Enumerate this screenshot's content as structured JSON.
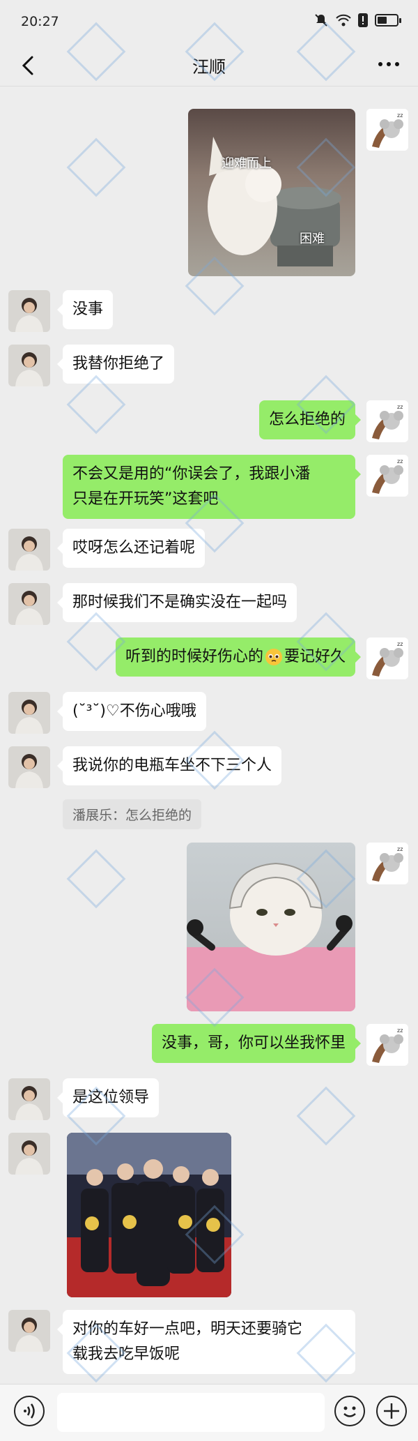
{
  "status": {
    "time": "20:27",
    "battery_level": 0.5
  },
  "header": {
    "title": "汪顺"
  },
  "messages": [
    {
      "text": "没事"
    },
    {
      "text": "我替你拒绝了"
    },
    {
      "text": "怎么拒绝的"
    },
    {
      "line1": "不会又是用的“你误会了，我跟小潘",
      "line2": "只是在开玩笑”这套吧"
    },
    {
      "text": "哎呀怎么还记着呢"
    },
    {
      "text": "那时候我们不是确实没在一起吗"
    },
    {
      "pre": "听到的时候好伤心的",
      "post": "要记好久"
    },
    {
      "text": "(˘³˘)♡不伤心哦哦"
    },
    {
      "text": "我说你的电瓶车坐不下三个人"
    },
    {
      "text": "没事，哥，你可以坐我怀里"
    },
    {
      "text": "是这位领导"
    },
    {
      "line1": "对你的车好一点吧，明天还要骑它",
      "line2": "载我去吃早饭呢"
    }
  ],
  "quote": {
    "text": "潘展乐：怎么拒绝的"
  },
  "sticker1": {
    "top_text": "迎难而上",
    "bottom_text": "困难"
  },
  "icons": {
    "back": "chevron-left-icon",
    "more": "more-icon",
    "voice": "voice-icon",
    "emoji": "emoji-icon",
    "plus": "plus-icon"
  }
}
